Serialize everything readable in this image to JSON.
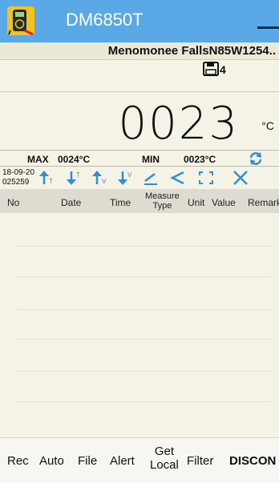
{
  "app": {
    "title": "DM6850T",
    "icon": "multimeter-app-icon",
    "menu_icon": "menu-dash-icon"
  },
  "header": {
    "location": "Menomonee FallsN85W1254..",
    "saved_count": "4",
    "save_icon": "floppy-disk-icon"
  },
  "reading": {
    "value": "0023",
    "unit": "°C"
  },
  "stats": {
    "max_label": "MAX",
    "max_value": "0024°C",
    "min_label": "MIN",
    "min_value": "0023°C",
    "refresh_icon": "refresh-icon"
  },
  "toolbar": {
    "date_line1": "18-09-20",
    "date_line2": "025259",
    "buttons": [
      "up-arrow-t-icon",
      "down-arrow-t-icon",
      "up-arrow-v-icon",
      "down-arrow-v-icon",
      "pencil-icon",
      "share-icon",
      "fullscreen-icon",
      "close-icon"
    ]
  },
  "table": {
    "columns": {
      "no": "No",
      "date": "Date",
      "time": "Time",
      "measure_line1": "Measure",
      "measure_line2": "Type",
      "unit": "Unit",
      "value": "Value",
      "remark": "Remark"
    },
    "rows": []
  },
  "bottom_nav": {
    "rec": "Rec",
    "auto": "Auto",
    "file": "File",
    "alert": "Alert",
    "get_local_line1": "Get",
    "get_local_line2": "Local",
    "filter": "Filter",
    "discon": "DISCON"
  },
  "colors": {
    "appbar": "#5aa9e6",
    "background": "#f5f2e6",
    "accent_icons": "#2f8fd6"
  }
}
